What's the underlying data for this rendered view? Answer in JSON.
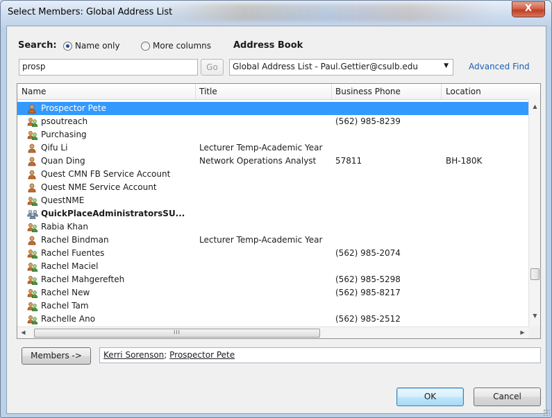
{
  "window": {
    "title": "Select Members: Global Address List",
    "close_glyph": "X"
  },
  "search": {
    "label": "Search:",
    "options": [
      "Name only",
      "More columns"
    ],
    "selected": "Name only",
    "value": "prosp",
    "go_label": "Go"
  },
  "address_book": {
    "label": "Address Book",
    "selected": "Global Address List - Paul.Gettier@csulb.edu",
    "advanced_find": "Advanced Find"
  },
  "table": {
    "columns": [
      "Name",
      "Title",
      "Business Phone",
      "Location"
    ],
    "rows": [
      {
        "name": "Prospector Pete",
        "title": "",
        "phone": "",
        "location": "",
        "icon": "user-icon",
        "selected": true,
        "bold": false
      },
      {
        "name": "psoutreach",
        "title": "",
        "phone": "(562) 985-8239",
        "location": "",
        "icon": "group-icon",
        "selected": false,
        "bold": false
      },
      {
        "name": "Purchasing",
        "title": "",
        "phone": "",
        "location": "",
        "icon": "group-icon",
        "selected": false,
        "bold": false
      },
      {
        "name": "Qifu Li",
        "title": "Lecturer Temp-Academic Year",
        "phone": "",
        "location": "",
        "icon": "user-icon",
        "selected": false,
        "bold": false
      },
      {
        "name": "Quan Ding",
        "title": "Network Operations Analyst",
        "phone": "57811",
        "location": "BH-180K",
        "icon": "user-icon",
        "selected": false,
        "bold": false
      },
      {
        "name": "Quest CMN FB Service Account",
        "title": "",
        "phone": "",
        "location": "",
        "icon": "user-icon",
        "selected": false,
        "bold": false
      },
      {
        "name": "Quest NME Service Account",
        "title": "",
        "phone": "",
        "location": "",
        "icon": "user-icon",
        "selected": false,
        "bold": false
      },
      {
        "name": "QuestNME",
        "title": "",
        "phone": "",
        "location": "",
        "icon": "group-icon",
        "selected": false,
        "bold": false
      },
      {
        "name": "QuickPlaceAdministratorsSU...",
        "title": "",
        "phone": "",
        "location": "",
        "icon": "distribution-list-icon",
        "selected": false,
        "bold": true
      },
      {
        "name": "Rabia Khan",
        "title": "",
        "phone": "",
        "location": "",
        "icon": "group-icon",
        "selected": false,
        "bold": false
      },
      {
        "name": "Rachel Bindman",
        "title": "Lecturer Temp-Academic Year",
        "phone": "",
        "location": "",
        "icon": "user-icon",
        "selected": false,
        "bold": false
      },
      {
        "name": "Rachel Fuentes",
        "title": "",
        "phone": "(562) 985-2074",
        "location": "",
        "icon": "group-icon",
        "selected": false,
        "bold": false
      },
      {
        "name": "Rachel Maciel",
        "title": "",
        "phone": "",
        "location": "",
        "icon": "group-icon",
        "selected": false,
        "bold": false
      },
      {
        "name": "Rachel Mahgerefteh",
        "title": "",
        "phone": "(562) 985-5298",
        "location": "",
        "icon": "group-icon",
        "selected": false,
        "bold": false
      },
      {
        "name": "Rachel New",
        "title": "",
        "phone": "(562) 985-8217",
        "location": "",
        "icon": "group-icon",
        "selected": false,
        "bold": false
      },
      {
        "name": "Rachel Tam",
        "title": "",
        "phone": "",
        "location": "",
        "icon": "group-icon",
        "selected": false,
        "bold": false
      },
      {
        "name": "Rachelle Ano",
        "title": "",
        "phone": "(562) 985-2512",
        "location": "",
        "icon": "group-icon",
        "selected": false,
        "bold": false
      }
    ],
    "hscroll_grip": "III"
  },
  "members": {
    "button_label": "Members ->",
    "selected": [
      "Kerri Sorenson",
      "Prospector Pete"
    ],
    "separator": "; "
  },
  "buttons": {
    "ok": "OK",
    "cancel": "Cancel"
  },
  "colors": {
    "selection": "#3399ff",
    "link": "#1a5fb4",
    "close": "#c13f22"
  }
}
